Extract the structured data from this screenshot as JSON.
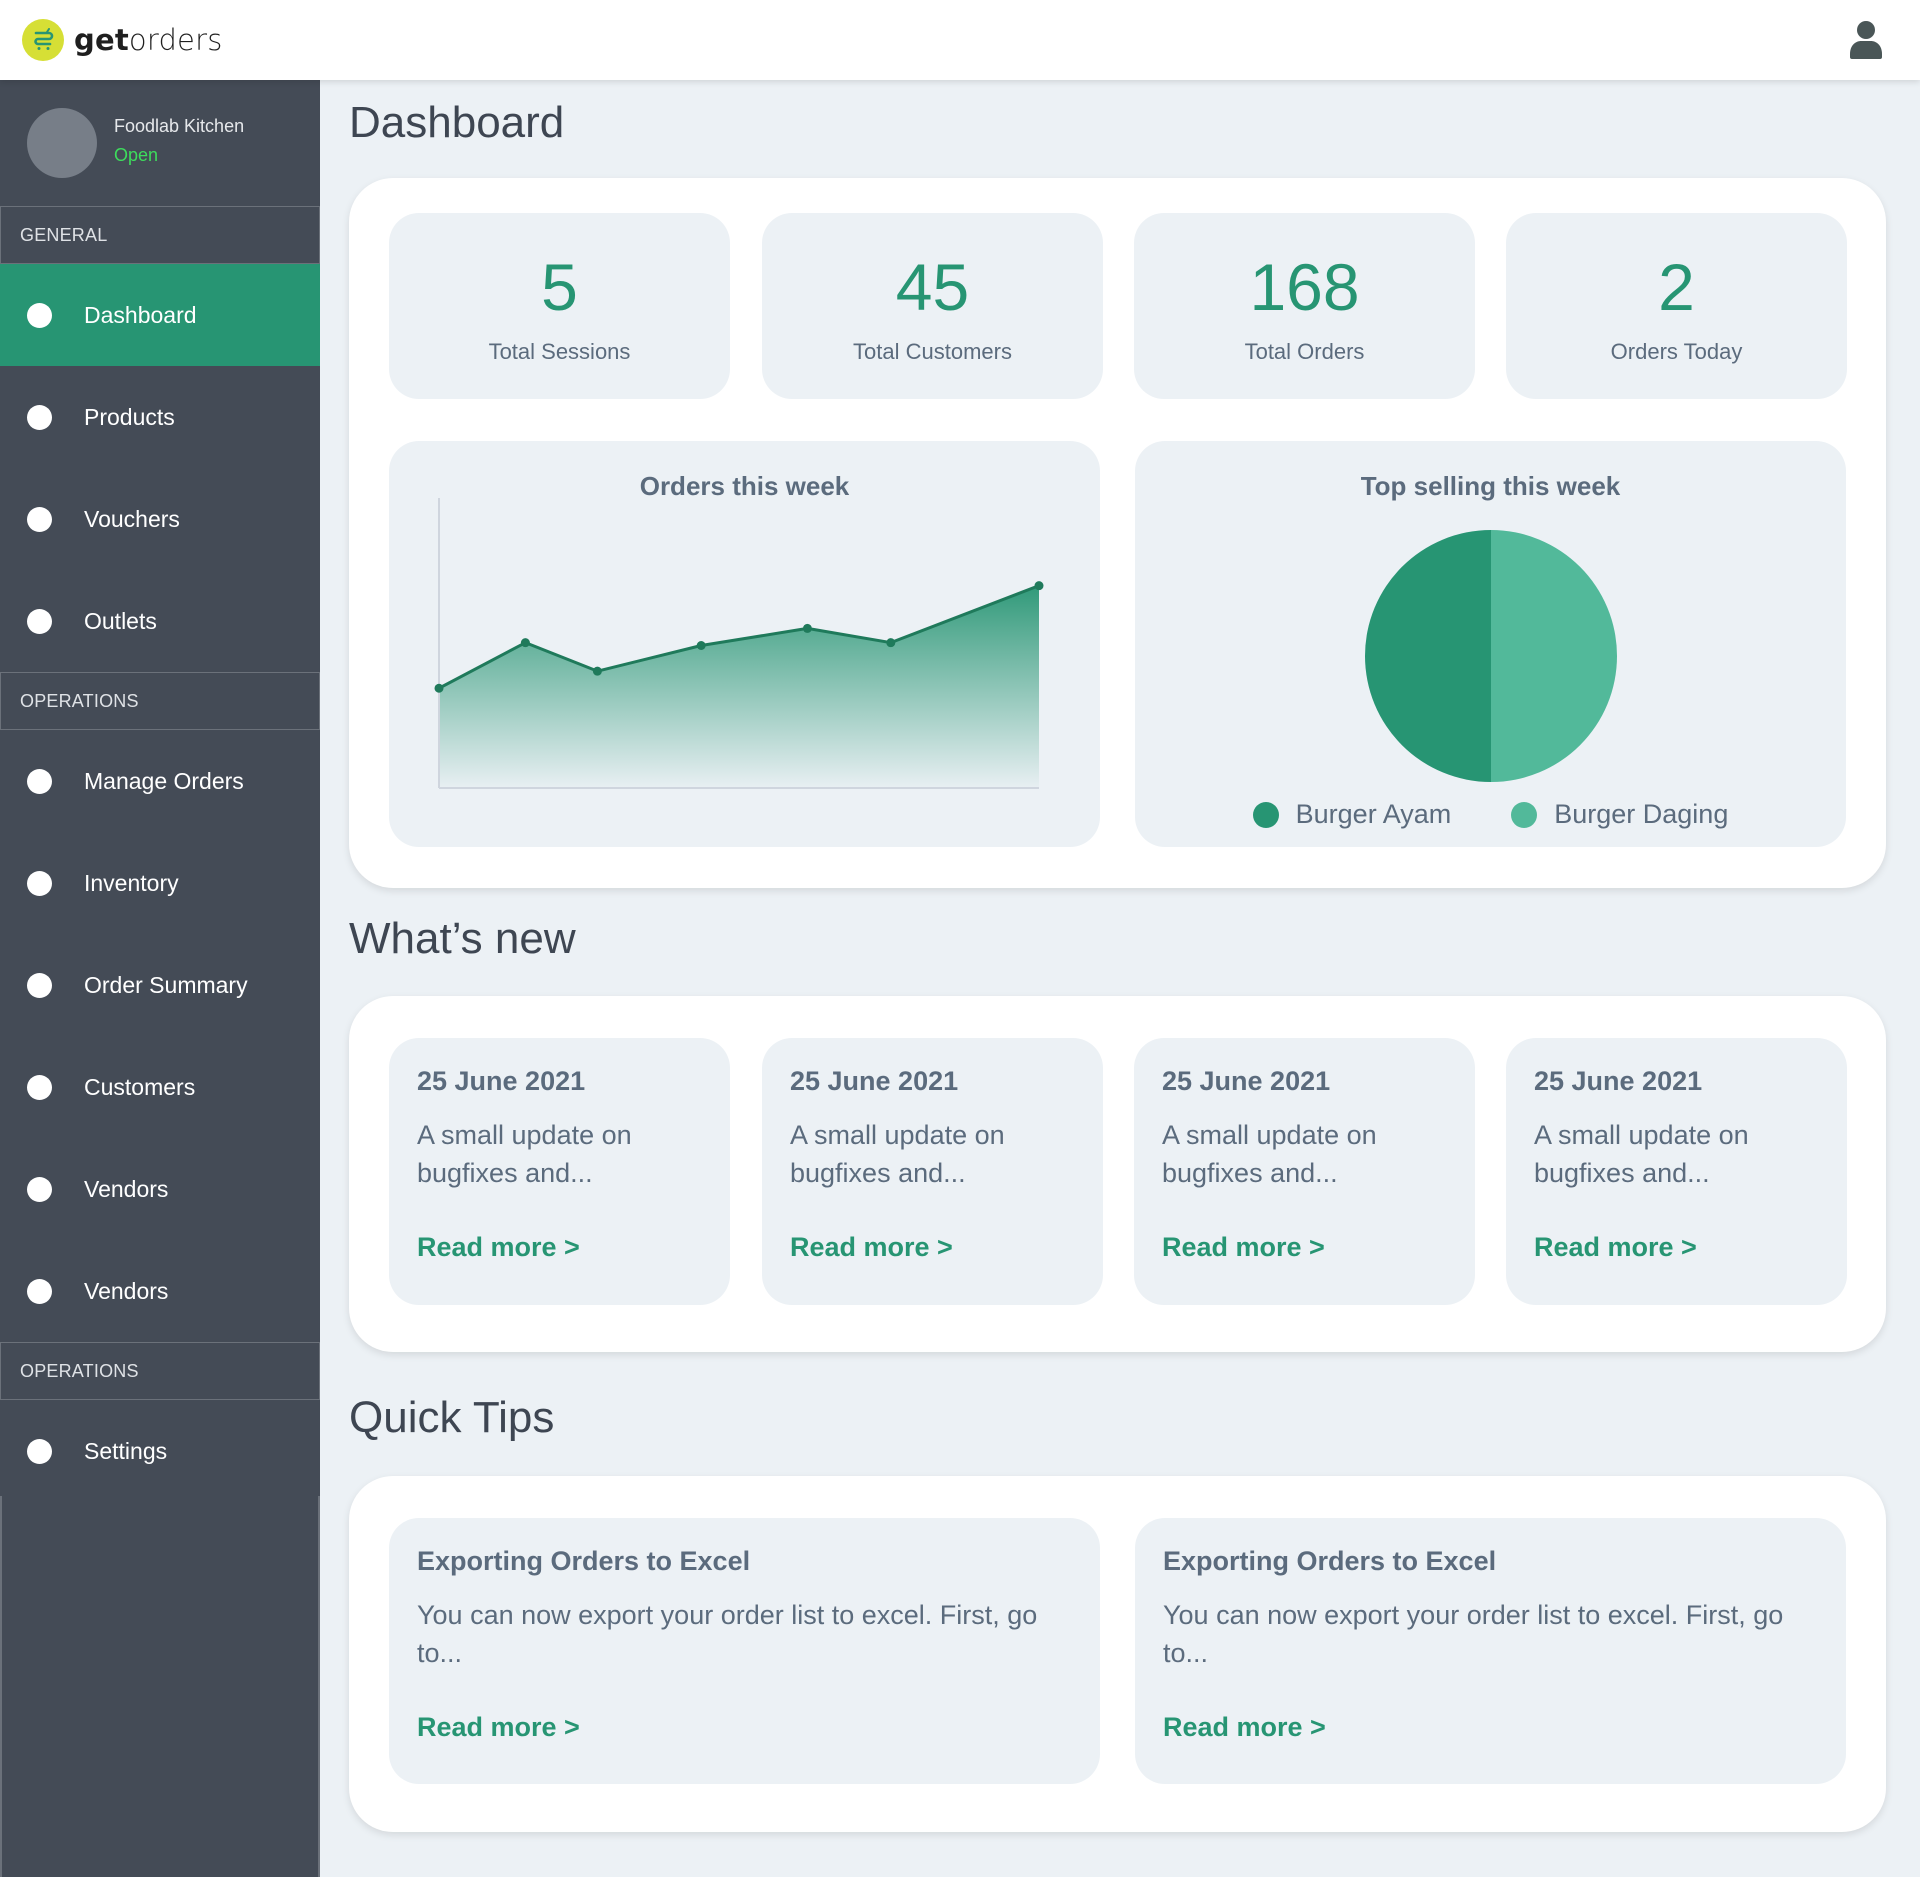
{
  "header": {
    "brand_bold": "get",
    "brand_light": "orders",
    "logo_icon": "shopping-cart-icon",
    "user_icon": "user-icon"
  },
  "sidebar": {
    "store_name": "Foodlab Kitchen",
    "store_status": "Open",
    "sections": [
      {
        "label": "GENERAL",
        "items": [
          {
            "label": "Dashboard",
            "active": true
          },
          {
            "label": "Products",
            "active": false
          },
          {
            "label": "Vouchers",
            "active": false
          },
          {
            "label": "Outlets",
            "active": false
          }
        ]
      },
      {
        "label": "OPERATIONS",
        "items": [
          {
            "label": "Manage Orders",
            "active": false
          },
          {
            "label": "Inventory",
            "active": false
          },
          {
            "label": "Order Summary",
            "active": false
          },
          {
            "label": "Customers",
            "active": false
          },
          {
            "label": "Vendors",
            "active": false
          },
          {
            "label": "Vendors",
            "active": false
          }
        ]
      },
      {
        "label": "OPERATIONS",
        "items": [
          {
            "label": "Settings",
            "active": false
          }
        ]
      }
    ]
  },
  "main": {
    "title": "Dashboard",
    "stats": [
      {
        "value": "5",
        "label": "Total Sessions"
      },
      {
        "value": "45",
        "label": "Total Customers"
      },
      {
        "value": "168",
        "label": "Total Orders"
      },
      {
        "value": "2",
        "label": "Orders Today"
      }
    ],
    "whats_new_title": "What’s new",
    "news": [
      {
        "date": "25 June 2021",
        "body": "A small update on bugfixes and...",
        "link": "Read more >"
      },
      {
        "date": "25 June 2021",
        "body": "A small update on bugfixes and...",
        "link": "Read more >"
      },
      {
        "date": "25 June 2021",
        "body": "A small update on bugfixes and...",
        "link": "Read more >"
      },
      {
        "date": "25 June 2021",
        "body": "A small update on bugfixes and...",
        "link": "Read more >"
      }
    ],
    "quick_tips_title": "Quick Tips",
    "tips": [
      {
        "title": "Exporting Orders to Excel",
        "body": "You can now export your order list to excel. First, go to...",
        "link": "Read more >"
      },
      {
        "title": "Exporting Orders to Excel",
        "body": "You can now export your order list to excel. First, go to...",
        "link": "Read more >"
      }
    ]
  },
  "colors": {
    "primary": "#279573",
    "primary_light": "#52b99a",
    "sidebar_bg": "#444b56",
    "page_bg": "#ecf1f5",
    "status_open": "#3ddc5c",
    "logo_bg": "#d6df35"
  },
  "chart_data": [
    {
      "type": "area",
      "title": "Orders this week",
      "xlabel": "",
      "ylabel": "",
      "grid": false,
      "x": [
        0,
        0.144,
        0.264,
        0.437,
        0.614,
        0.753,
        1.0
      ],
      "values": [
        35,
        51,
        41,
        50,
        56,
        51,
        71
      ],
      "ylim": [
        0,
        100
      ],
      "note": "no axis ticks or labels shown; values estimated relative to plot height"
    },
    {
      "type": "pie",
      "title": "Top selling this week",
      "categories": [
        "Burger Ayam",
        "Burger Daging"
      ],
      "values": [
        50,
        50
      ],
      "colors": [
        "#279573",
        "#52b99a"
      ],
      "legend": "bottom"
    }
  ]
}
